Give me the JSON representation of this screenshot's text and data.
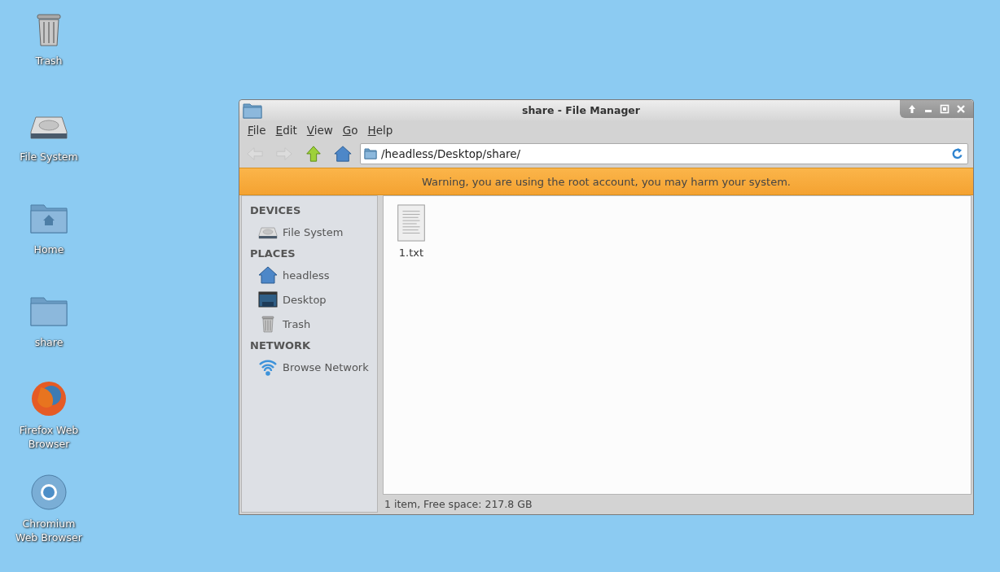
{
  "desktop_icons": [
    {
      "label": "Trash",
      "kind": "trash"
    },
    {
      "label": "File System",
      "kind": "drive"
    },
    {
      "label": "Home",
      "kind": "home-folder"
    },
    {
      "label": "share",
      "kind": "folder"
    },
    {
      "label": "Firefox Web Browser",
      "kind": "firefox"
    },
    {
      "label": "Chromium Web Browser",
      "kind": "chromium"
    }
  ],
  "window": {
    "title": "share - File Manager"
  },
  "menu": [
    {
      "label": "File"
    },
    {
      "label": "Edit"
    },
    {
      "label": "View"
    },
    {
      "label": "Go"
    },
    {
      "label": "Help"
    }
  ],
  "toolbar": [
    {
      "kind": "back",
      "disabled": true
    },
    {
      "kind": "forward",
      "disabled": true
    },
    {
      "kind": "up",
      "disabled": false
    },
    {
      "kind": "home",
      "disabled": false
    }
  ],
  "location": {
    "value": "/headless/Desktop/share/"
  },
  "warning": "Warning, you are using the root account, you may harm your system.",
  "sidebar": [
    {
      "heading": "DEVICES",
      "items": [
        {
          "label": "File System",
          "kind": "drive"
        }
      ]
    },
    {
      "heading": "PLACES",
      "items": [
        {
          "label": "headless",
          "kind": "home"
        },
        {
          "label": "Desktop",
          "kind": "desktop"
        },
        {
          "label": "Trash",
          "kind": "trash"
        }
      ]
    },
    {
      "heading": "NETWORK",
      "items": [
        {
          "label": "Browse Network",
          "kind": "network"
        }
      ]
    }
  ],
  "files": [
    {
      "name": "1.txt",
      "kind": "text"
    }
  ],
  "status_bar": "1 item, Free space: 217.8 GB"
}
